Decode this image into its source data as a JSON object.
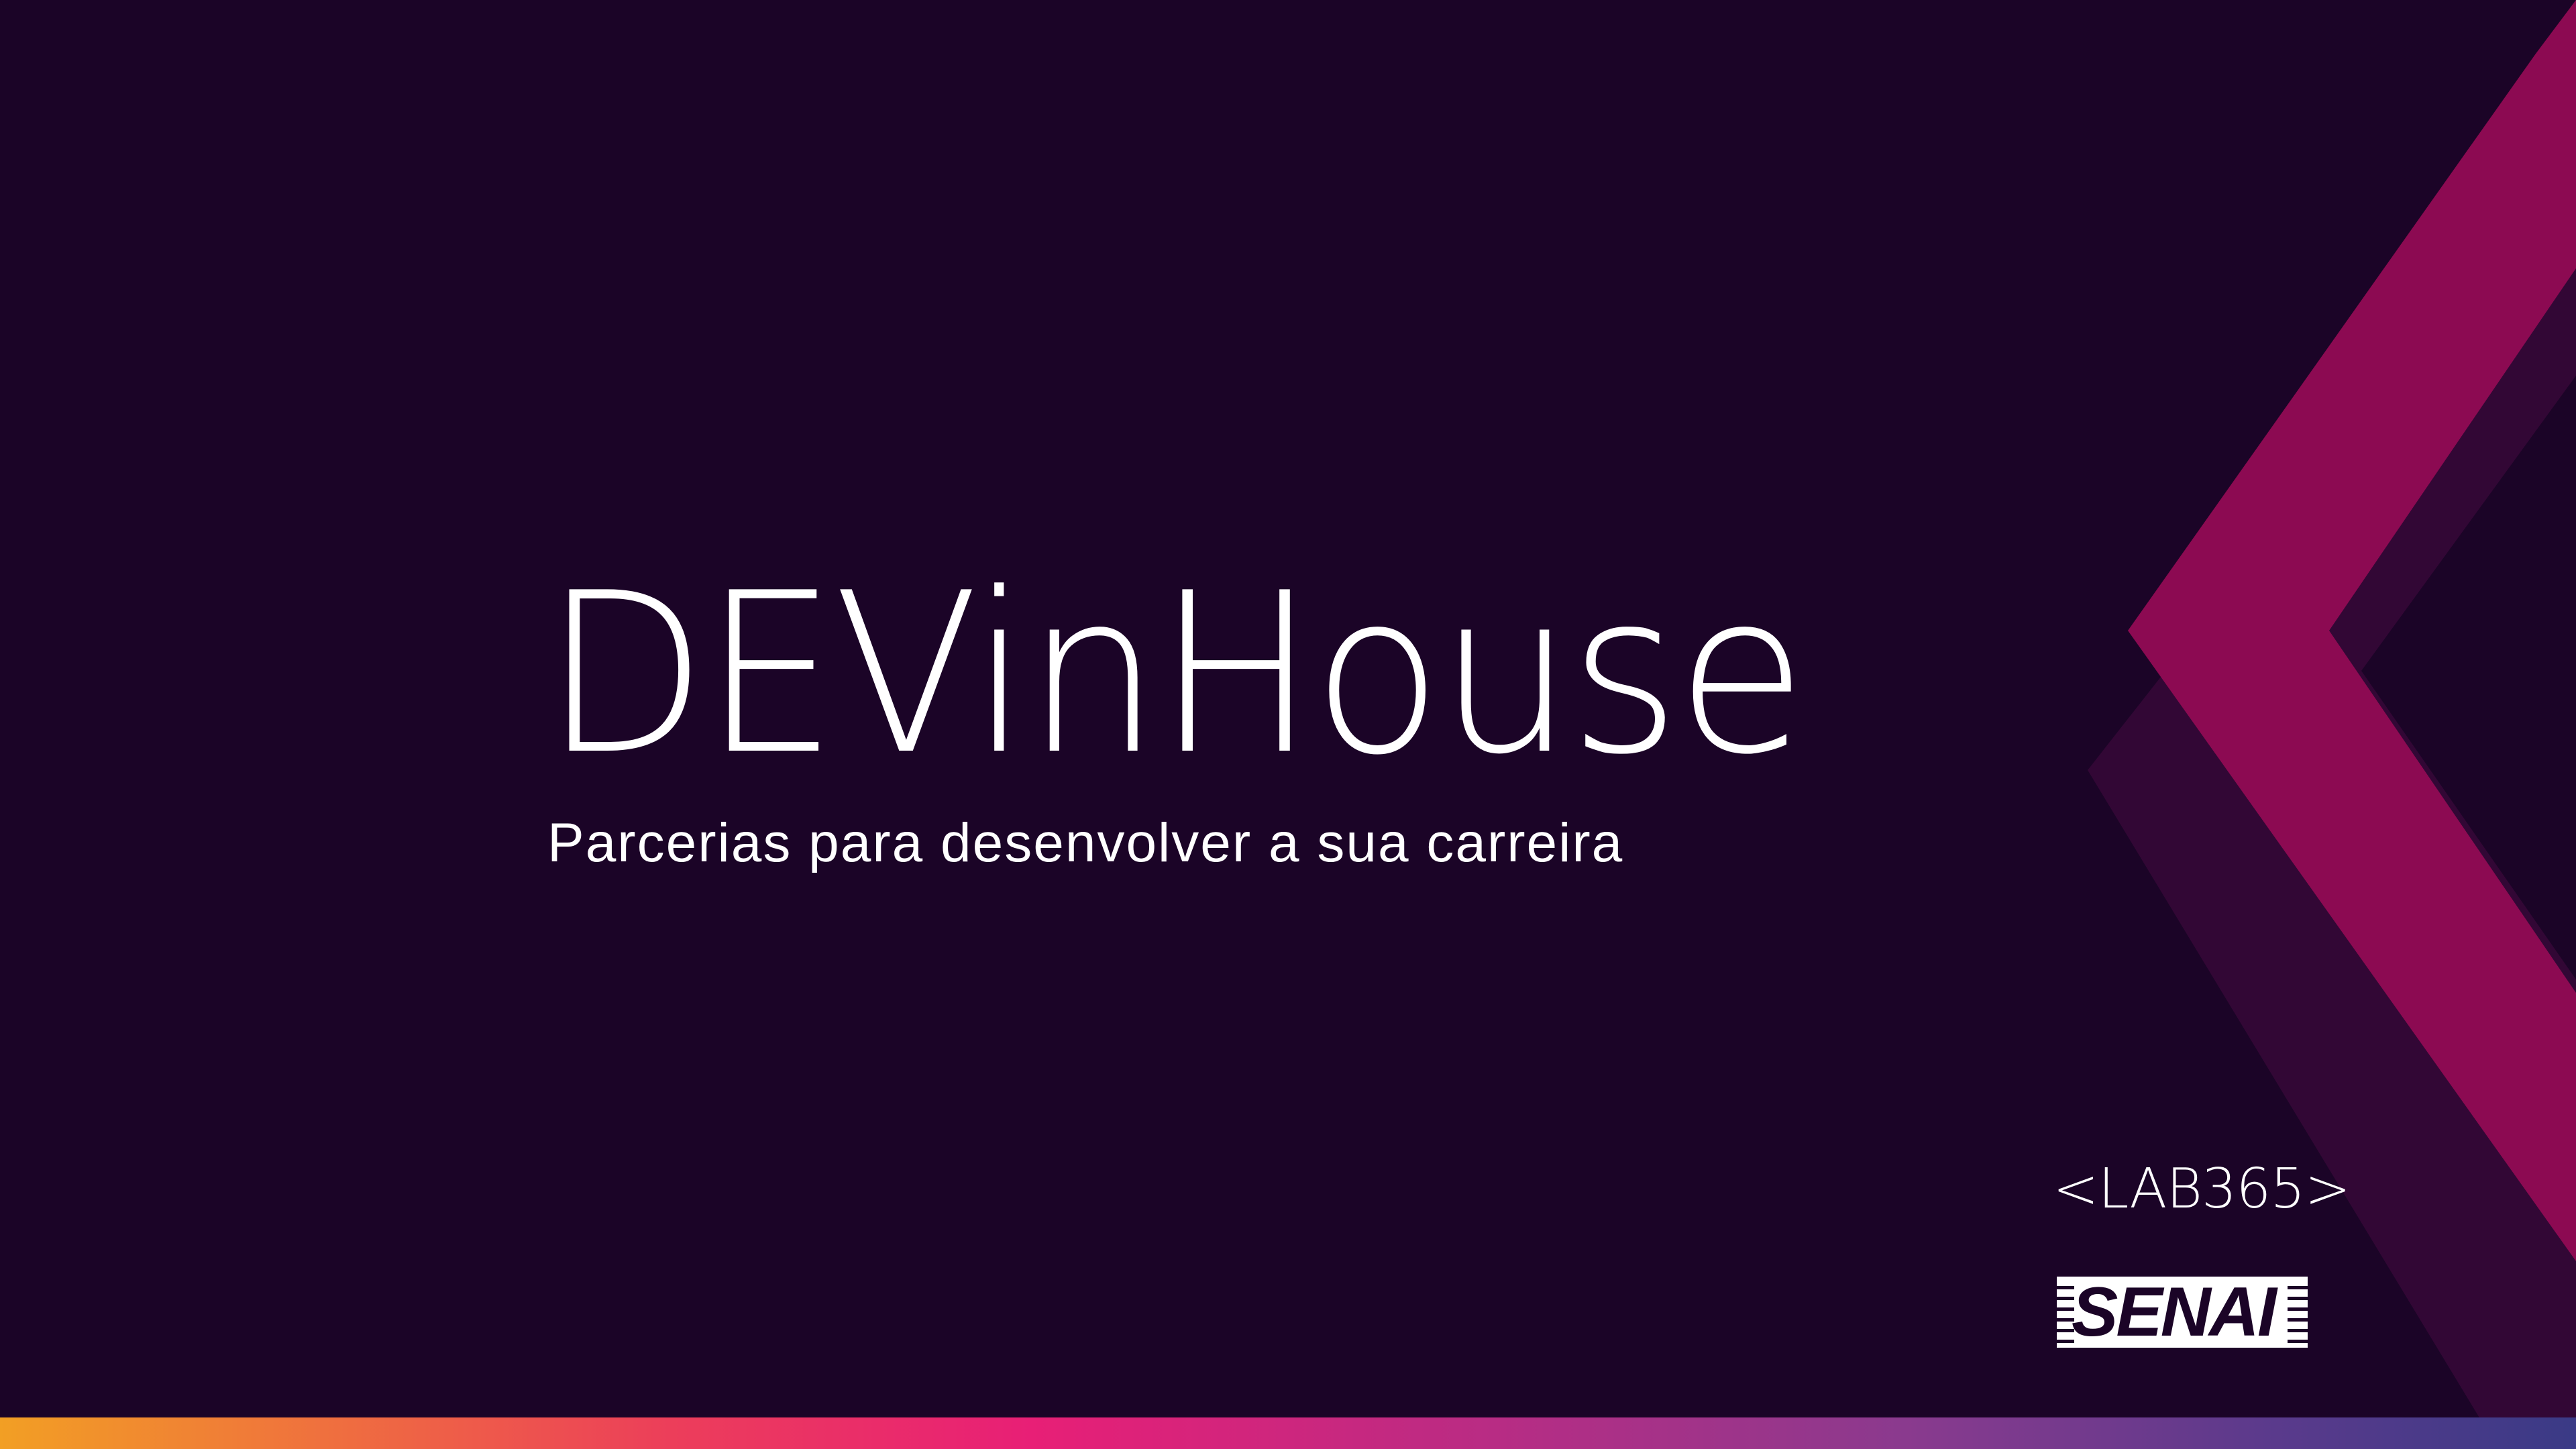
{
  "slide": {
    "title": "DEVinHouse",
    "subtitle": "Parcerias para desenvolver a sua carreira",
    "lab_label": "<LAB365>",
    "senai_label": "SENAI"
  },
  "colors": {
    "background": "#1b0427",
    "chevron_front": "#8c0a52",
    "chevron_back": "#320735",
    "text": "#ffffff",
    "bar_start": "#f29f24",
    "bar_mid": "#e81f76",
    "bar_end": "#3a3a86"
  }
}
